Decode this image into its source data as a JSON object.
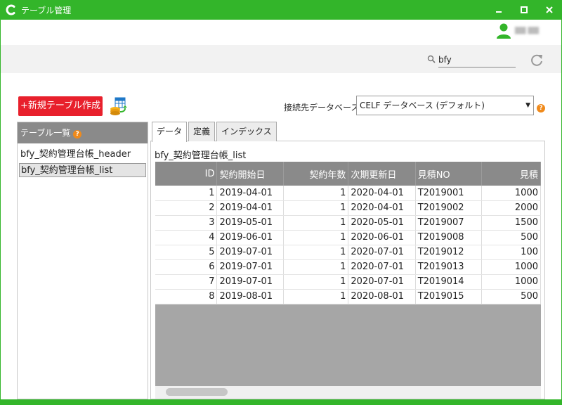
{
  "window": {
    "title": "テーブル管理",
    "accent": "#33b52a"
  },
  "user": {
    "name": "▇▇ ▇▇"
  },
  "search": {
    "value": "bfy"
  },
  "toolbar": {
    "new_table_label": "+新規テーブル作成",
    "connection_label": "接続先データベース",
    "connection_value": "CELF データベース (デフォルト)"
  },
  "left_panel": {
    "header": "テーブル一覧",
    "items": [
      {
        "label": "bfy_契約管理台帳_header"
      },
      {
        "label": "bfy_契約管理台帳_list"
      }
    ]
  },
  "tabs": [
    {
      "label": "データ"
    },
    {
      "label": "定義"
    },
    {
      "label": "インデックス"
    }
  ],
  "table_view": {
    "table_name": "bfy_契約管理台帳_list",
    "columns": [
      "ID",
      "契約開始日",
      "契約年数",
      "次期更新日",
      "見積NO",
      "見積"
    ],
    "rows": [
      [
        "1",
        "2019-04-01",
        "1",
        "2020-04-01",
        "T2019001",
        "1000"
      ],
      [
        "2",
        "2019-04-01",
        "1",
        "2020-04-01",
        "T2019002",
        "2000"
      ],
      [
        "3",
        "2019-05-01",
        "1",
        "2020-05-01",
        "T2019007",
        "1500"
      ],
      [
        "4",
        "2019-06-01",
        "1",
        "2020-06-01",
        "T2019008",
        "500"
      ],
      [
        "5",
        "2019-07-01",
        "1",
        "2020-07-01",
        "T2019012",
        "100"
      ],
      [
        "6",
        "2019-07-01",
        "1",
        "2020-07-01",
        "T2019013",
        "1000"
      ],
      [
        "7",
        "2019-07-01",
        "1",
        "2020-07-01",
        "T2019014",
        "1000"
      ],
      [
        "8",
        "2019-08-01",
        "1",
        "2020-08-01",
        "T2019015",
        "500"
      ]
    ]
  }
}
